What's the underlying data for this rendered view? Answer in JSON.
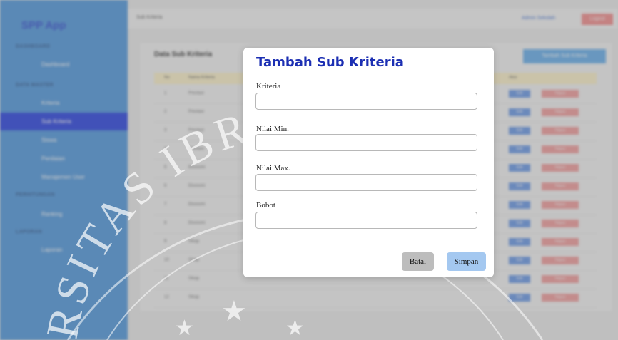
{
  "modal": {
    "title": "Tambah Sub Kriteria",
    "fields": [
      {
        "label": "Kriteria",
        "value": ""
      },
      {
        "label": "Nilai Min.",
        "value": ""
      },
      {
        "label": "Nilai Max.",
        "value": ""
      },
      {
        "label": "Bobot",
        "value": ""
      }
    ],
    "cancel_label": "Batal",
    "save_label": "Simpan"
  },
  "watermark": {
    "text": "RSITAS IBRA"
  },
  "colors": {
    "modal_title": "#1c2fb3",
    "sidebar": "#3f8fdc",
    "sidebar_active": "#1430e0",
    "overlay": "#808080"
  }
}
